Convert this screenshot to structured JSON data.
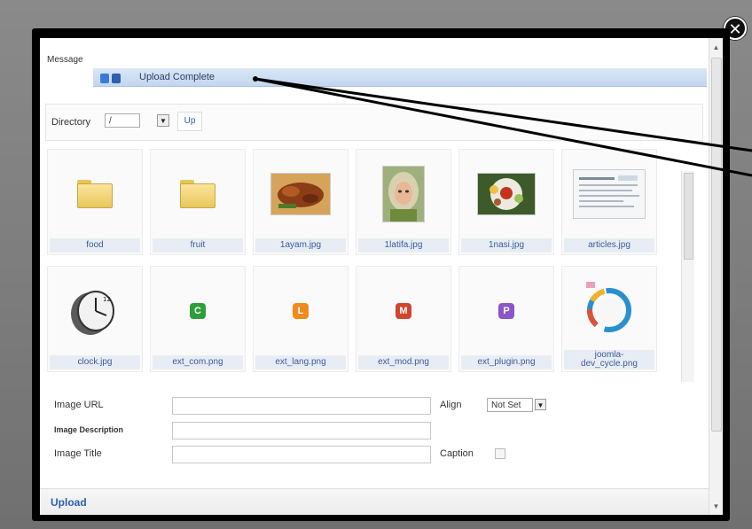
{
  "message": {
    "label": "Message",
    "text": "Upload Complete"
  },
  "directory": {
    "label": "Directory",
    "value": "/",
    "up_label": "Up"
  },
  "files": [
    {
      "name": "food",
      "kind": "folder"
    },
    {
      "name": "fruit",
      "kind": "folder"
    },
    {
      "name": "1ayam.jpg",
      "kind": "photo"
    },
    {
      "name": "1latifa.jpg",
      "kind": "photo"
    },
    {
      "name": "1nasi.jpg",
      "kind": "photo"
    },
    {
      "name": "articles.jpg",
      "kind": "photo"
    },
    {
      "name": "clock.jpg",
      "kind": "photo"
    },
    {
      "name": "ext_com.png",
      "kind": "icon",
      "letter": "C",
      "color": "#2e9e3a"
    },
    {
      "name": "ext_lang.png",
      "kind": "icon",
      "letter": "L",
      "color": "#f08a1c"
    },
    {
      "name": "ext_mod.png",
      "kind": "icon",
      "letter": "M",
      "color": "#d0452e"
    },
    {
      "name": "ext_plugin.png",
      "kind": "icon",
      "letter": "P",
      "color": "#8a56c8"
    },
    {
      "name": "joomla-dev_cycle.png",
      "kind": "photo",
      "label_line1": "joomla-",
      "label_line2": "dev_cycle.png"
    }
  ],
  "form": {
    "image_url_label": "Image URL",
    "image_description_label": "Image Description",
    "image_title_label": "Image Title",
    "align_label": "Align",
    "align_value": "Not Set",
    "caption_label": "Caption"
  },
  "upload": {
    "label": "Upload"
  },
  "icons": {
    "close": "close-icon",
    "dropdown": "chevron-down-icon"
  }
}
